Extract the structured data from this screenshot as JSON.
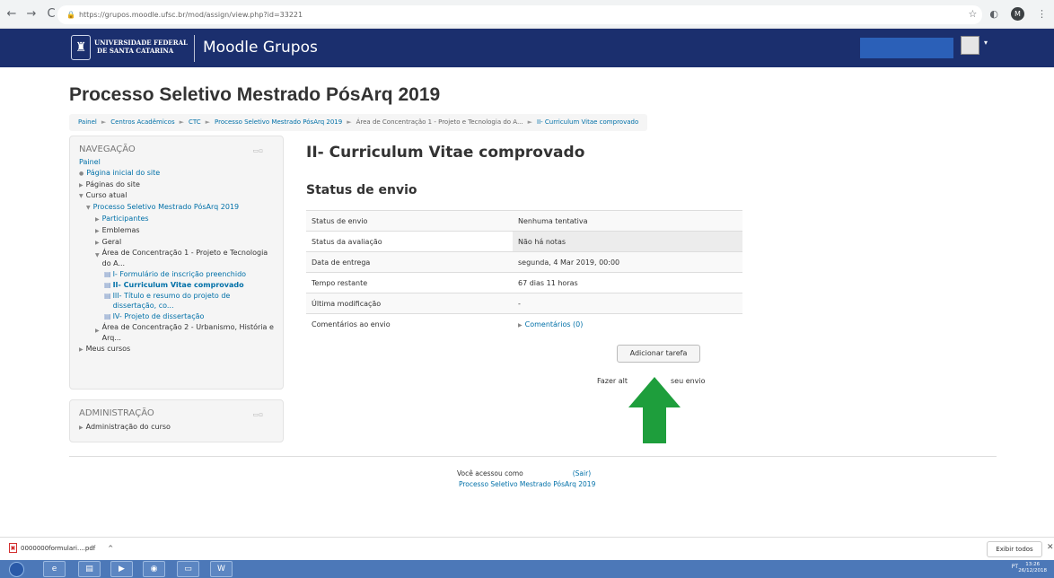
{
  "browser": {
    "url": "https://grupos.moodle.ufsc.br/mod/assign/view.php?id=33221",
    "back": "←",
    "forward": "→",
    "reload": "C",
    "star": "☆",
    "profile_initial": "M"
  },
  "header": {
    "university_line1": "UNIVERSIDADE FEDERAL",
    "university_line2": "DE SANTA CATARINA",
    "site_name": "Moodle Grupos"
  },
  "page": {
    "title": "Processo Seletivo Mestrado PósArq 2019",
    "breadcrumb": [
      "Painel",
      "Centros Acadêmicos",
      "CTC",
      "Processo Seletivo Mestrado PósArq 2019",
      "Área de Concentração 1 - Projeto e Tecnologia do A...",
      "II- Curriculum Vitae comprovado"
    ]
  },
  "navigation": {
    "title": "NAVEGAÇÃO",
    "items": [
      "Painel",
      "Página inicial do site",
      "Páginas do site",
      "Curso atual",
      "Processo Seletivo Mestrado PósArq 2019",
      "Participantes",
      "Emblemas",
      "Geral",
      "Área de Concentração 1 - Projeto e Tecnologia do A...",
      "I- Formulário de inscrição preenchido",
      "II- Curriculum Vitae comprovado",
      "III- Título e resumo do projeto de dissertação, co...",
      "IV- Projeto de dissertação",
      "Área de Concentração 2 - Urbanismo, História e Arq...",
      "Meus cursos"
    ]
  },
  "administration": {
    "title": "ADMINISTRAÇÃO",
    "item": "Administração do curso"
  },
  "assignment": {
    "heading": "II- Curriculum Vitae comprovado",
    "section_heading": "Status de envio",
    "rows": [
      {
        "label": "Status de envio",
        "value": "Nenhuma tentativa"
      },
      {
        "label": "Status da avaliação",
        "value": "Não há notas"
      },
      {
        "label": "Data de entrega",
        "value": "segunda, 4 Mar 2019, 00:00"
      },
      {
        "label": "Tempo restante",
        "value": "67 dias 11 horas"
      },
      {
        "label": "Última modificação",
        "value": "-"
      },
      {
        "label": "Comentários ao envio",
        "value": "Comentários (0)"
      }
    ],
    "add_button": "Adicionar tarefa",
    "edit_note_left": "Fazer alt",
    "edit_note_right": "seu envio"
  },
  "footer": {
    "logged_in": "Você acessou como",
    "logout": "(Sair)",
    "course": "Processo Seletivo Mestrado PósArq 2019"
  },
  "downloads": {
    "file": "0000000formulari....pdf",
    "show_all": "Exibir todos"
  },
  "taskbar": {
    "tray": "PT",
    "time": "13:26",
    "date": "26/12/2018"
  },
  "colors": {
    "header_bg": "#1b2f6e",
    "link": "#0070a8",
    "arrow": "#1e9e3c"
  }
}
